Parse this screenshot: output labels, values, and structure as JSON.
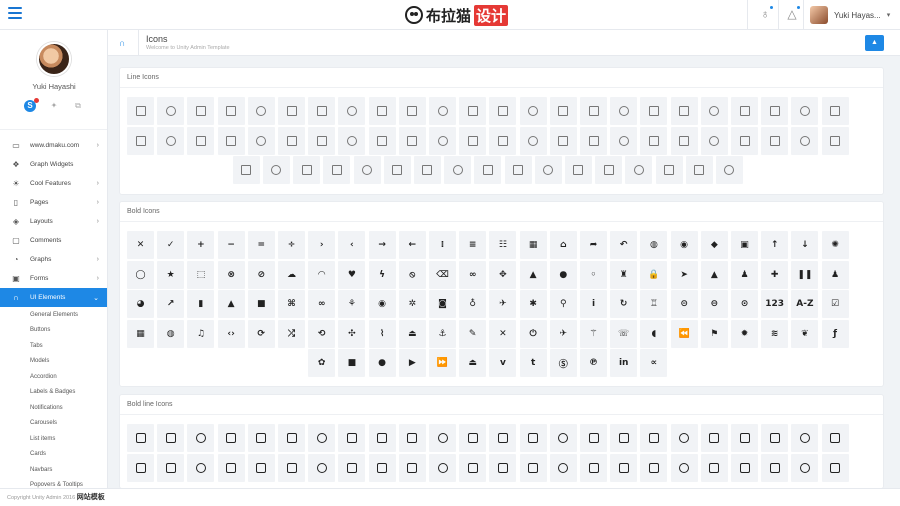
{
  "topbar": {
    "logo": {
      "text": "布拉猫",
      "highlight": "设计"
    },
    "user_name": "Yuki Hayas..."
  },
  "sidebar": {
    "profile_name": "Yuki Hayashi",
    "skype_label": "S",
    "nav": [
      {
        "label": "www.dmaku.com",
        "icon": "laptop-icon",
        "glyph": "▭",
        "chevron": true
      },
      {
        "label": "Graph Widgets",
        "icon": "widget-icon",
        "glyph": "❖",
        "chevron": false
      },
      {
        "label": "Cool Features",
        "icon": "sun-icon",
        "glyph": "☀",
        "chevron": true
      },
      {
        "label": "Pages",
        "icon": "page-icon",
        "glyph": "▯",
        "chevron": true
      },
      {
        "label": "Layouts",
        "icon": "layers-icon",
        "glyph": "◈",
        "chevron": true
      },
      {
        "label": "Comments",
        "icon": "comment-icon",
        "glyph": "▢",
        "chevron": false
      },
      {
        "label": "Graphs",
        "icon": "pie-icon",
        "glyph": "◔",
        "chevron": true
      },
      {
        "label": "Forms",
        "icon": "form-icon",
        "glyph": "▣",
        "chevron": true
      },
      {
        "label": "UI Elements",
        "icon": "magnet-icon",
        "glyph": "∩",
        "chevron": true,
        "active": true
      }
    ],
    "subnav": [
      "General Elements",
      "Buttons",
      "Tabs",
      "Models",
      "Accordion",
      "Labels & Badges",
      "Notifications",
      "Carousels",
      "List items",
      "Cards",
      "Navbars",
      "Popovers & Tooltips"
    ]
  },
  "page_header": {
    "title": "Icons",
    "subtitle": "Welcome to Unity Admin Template"
  },
  "cards": {
    "line": {
      "title": "Line Icons",
      "rows": [
        24,
        24,
        17
      ]
    },
    "bold": {
      "title": "Bold Icons",
      "rows": [
        24,
        24,
        24,
        24,
        12
      ]
    },
    "boldline": {
      "title": "Bold line Icons",
      "rows": [
        24,
        24
      ]
    }
  },
  "bold_glyphs": [
    "✕",
    "✓",
    "+",
    "−",
    "=",
    "÷",
    "›",
    "‹",
    "→",
    "←",
    "⁞",
    "≡",
    "☷",
    "▦",
    "⌂",
    "➦",
    "↶",
    "◍",
    "◉",
    "◆",
    "▣",
    "↑",
    "↓",
    "✺",
    "◯",
    "★",
    "⬚",
    "⊗",
    "⊘",
    "☁",
    "◠",
    "♥",
    "ϟ",
    "⦸",
    "⌫",
    "∞",
    "✥",
    "▲",
    "●",
    "◦",
    "♜",
    "🔒",
    "➤",
    "▲",
    "♟",
    "✚",
    "❚❚",
    "♟",
    "◕",
    "↗",
    "▮",
    "▲",
    "■",
    "⌘",
    "∞",
    "⚘",
    "◉",
    "✲",
    "◙",
    "♁",
    "✈",
    "✱",
    "⚲",
    "ⅰ",
    "↻",
    "♖",
    "⊝",
    "⊖",
    "⊙",
    "123",
    "A-Z",
    "☑",
    "▦",
    "◍",
    "♫",
    "‹›",
    "⟳",
    "⤮",
    "⟲",
    "✣",
    "⌇",
    "⏏",
    "⚓",
    "✎",
    "✕",
    "⏻",
    "✈",
    "⚚",
    "☏",
    "◖",
    "⏪",
    "⚑",
    "✹",
    "≋",
    "❦",
    "ƒ",
    "✿",
    "■",
    "●",
    "▶",
    "⏩",
    "⏏",
    "ⅴ",
    "t",
    "Ⓢ",
    "℗",
    "in",
    "∝",
    "♞",
    "●●",
    "@"
  ]
}
